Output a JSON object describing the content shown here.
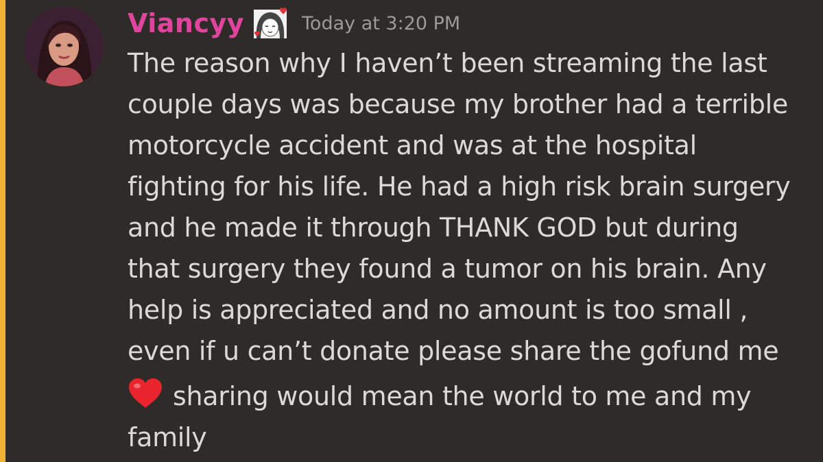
{
  "message": {
    "author": {
      "username": "Viancyy",
      "username_color": "#e0459e",
      "avatar_icon": "user-avatar-icon",
      "badge_icon": "anime-girl-with-hearts-icon"
    },
    "timestamp": "Today at 3:20 PM",
    "lines": [
      "The reason why I haven’t been streaming the last",
      "couple days was because my brother had a terrible",
      "motorcycle accident and was at the hospital",
      "fighting for his life. He had a high risk brain surgery",
      "and he made it through THANK GOD but during",
      "that surgery they found a tumor on his brain. Any",
      "help is appreciated and no amount is too small ,",
      "even if u can’t donate please share the gofund me"
    ],
    "emoji": "red-heart-icon",
    "emoji_line": "sharing would mean the world to me and my",
    "last_line": "family"
  },
  "colors": {
    "background": "#2f2b29",
    "accent_bar": "#f0b232",
    "text": "#dcd9d6",
    "timestamp": "#9e9a97"
  }
}
